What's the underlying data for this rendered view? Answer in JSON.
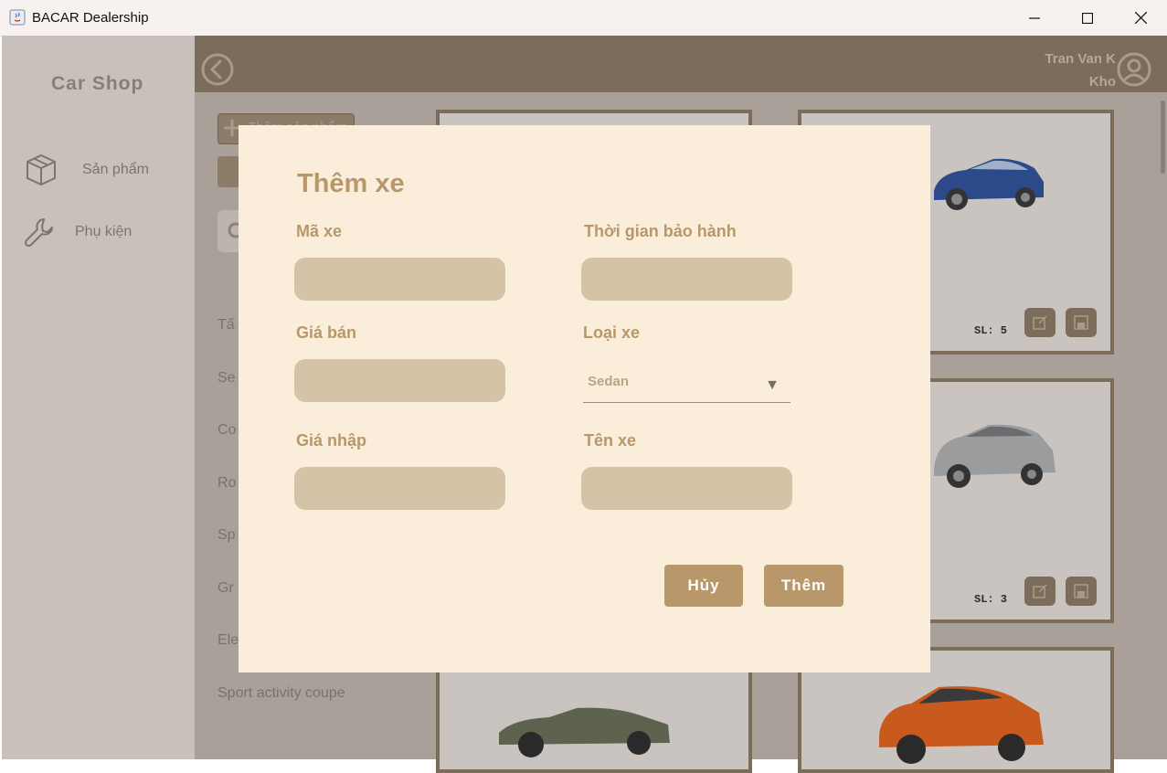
{
  "window": {
    "title": "BACAR Dealership"
  },
  "sidebar": {
    "brand": "Car Shop",
    "items": [
      {
        "label": "Sản phẩm",
        "icon": "box-icon"
      },
      {
        "label": "Phụ kiện",
        "icon": "wrench-icon"
      }
    ]
  },
  "header": {
    "user_name": "Tran Van K",
    "user_role": "Kho"
  },
  "filters": {
    "add_button": "Thêm sản phẩm",
    "categories": [
      "Tấ",
      "Se",
      "Co",
      "Ro",
      "Sp",
      "Gr",
      "Ele",
      "Sport activity coupe"
    ]
  },
  "cards": [
    {
      "sl": "SL: 5"
    },
    {
      "sl": "SL: 3"
    }
  ],
  "modal": {
    "title": "Thêm xe",
    "fields": {
      "ma_xe": {
        "label": "Mã xe",
        "value": ""
      },
      "thoi_gian": {
        "label": "Thời gian bảo hành",
        "value": ""
      },
      "gia_ban": {
        "label": "Giá bán",
        "value": ""
      },
      "loai_xe": {
        "label": "Loại xe",
        "value": "Sedan"
      },
      "gia_nhap": {
        "label": "Giá nhập",
        "value": ""
      },
      "ten_xe": {
        "label": "Tên xe",
        "value": ""
      }
    },
    "cancel_label": "Hủy",
    "submit_label": "Thêm"
  },
  "colors": {
    "accent": "#b8976a",
    "header": "#7c6c5a",
    "modal_bg": "#faeeda",
    "input_bg": "#d4c3a7"
  }
}
